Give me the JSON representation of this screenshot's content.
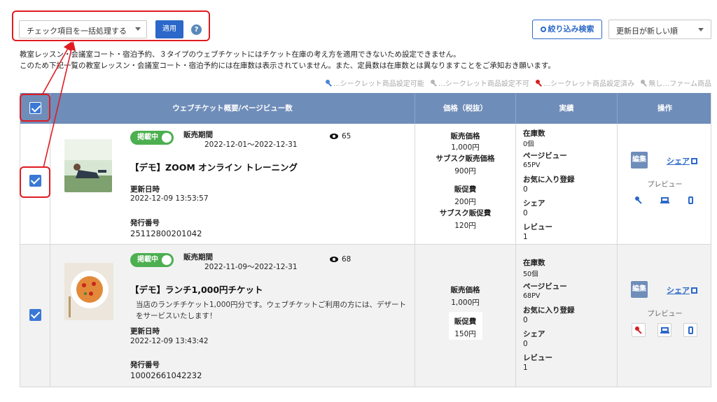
{
  "toolbar": {
    "bulk_action": "チェック項目を一括処理する",
    "apply_label": "適用",
    "help": "?",
    "filter_label": "絞り込み検索",
    "sort_value": "更新日が新しい順"
  },
  "notice": {
    "line1": "教室レッスン・会議室コート・宿泊予約、３タイプのウェブチケットにはチケット在庫の考え方を適用できないため設定できません。",
    "line2": "このため下記一覧の教室レッスン・会議室コート・宿泊予約には在庫数は表示されていません。また、定員数は在庫数とは異なりますことをご承知おき願います。"
  },
  "legend": {
    "items": [
      {
        "label": "…シークレット商品設定可能",
        "color": "#4a86d8"
      },
      {
        "label": "…シークレット商品設定不可",
        "color": "#b5b5b5"
      },
      {
        "label": "…シークレット商品設定済み",
        "color": "#d62020"
      },
      {
        "label": "無し…ファーム商品",
        "color": "#b5b5b5"
      }
    ]
  },
  "table": {
    "headers": {
      "summary": "ウェブチケット概要/ページビュー数",
      "price": "価格（税抜）",
      "results": "実績",
      "actions": "操作"
    }
  },
  "rows": [
    {
      "status": "掲載中",
      "period_label": "販売期間",
      "period": "2022-12-01〜2022-12-31",
      "views": "65",
      "title": "【デモ】ZOOM オンライン トレーニング",
      "description": "",
      "updated_label": "更新日時",
      "updated": "2022-12-09 13:53:57",
      "number_label": "発行番号",
      "number": "25112800201042",
      "price": {
        "sale_label": "販売価格",
        "sale": "1,000円",
        "sub_label": "サブスク販売価格",
        "sub": "900円",
        "promo_label": "販促費",
        "promo": "200円",
        "sub_promo_label": "サブスク販促費",
        "sub_promo": "120円"
      },
      "results": {
        "stock_label": "在庫数",
        "stock": "0個",
        "pv_label": "ページビュー",
        "pv": "65PV",
        "fav_label": "お気に入り登録",
        "fav": "0",
        "share_label": "シェア",
        "share": "0",
        "review_label": "レビュー",
        "review": "1"
      },
      "actions": {
        "edit": "編集",
        "share": "シェア",
        "preview": "プレビュー",
        "key_color": "#2b68c9"
      }
    },
    {
      "status": "掲載中",
      "period_label": "販売期間",
      "period": "2022-11-09〜2022-12-31",
      "views": "68",
      "title": "【デモ】ランチ1,000円チケット",
      "description": "当店のランチチケット1,000円分です。ウェブチケットご利用の方には、デザートをサービスいたします！",
      "updated_label": "更新日時",
      "updated": "2022-12-09 13:43:42",
      "number_label": "発行番号",
      "number": "10002661042232",
      "price": {
        "sale_label": "販売価格",
        "sale": "1,000円",
        "promo_label": "販促費",
        "promo": "150円"
      },
      "results": {
        "stock_label": "在庫数",
        "stock": "50個",
        "pv_label": "ページビュー",
        "pv": "68PV",
        "fav_label": "お気に入り登録",
        "fav": "0",
        "share_label": "シェア",
        "share": "0",
        "review_label": "レビュー",
        "review": "1"
      },
      "actions": {
        "edit": "編集",
        "share": "シェア",
        "preview": "プレビュー",
        "key_color": "#d62020"
      }
    }
  ]
}
